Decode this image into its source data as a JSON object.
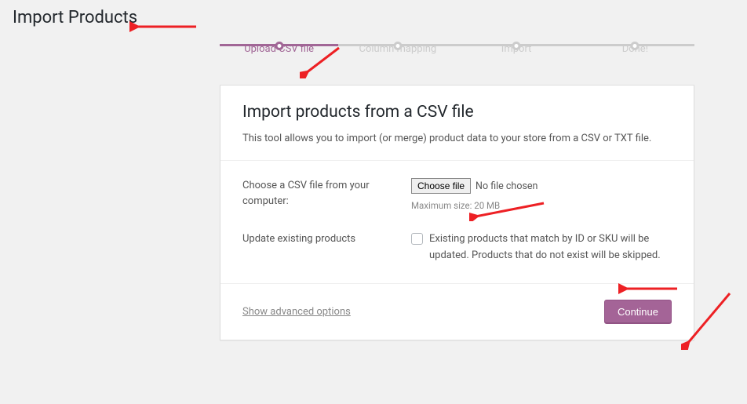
{
  "page_title": "Import Products",
  "steps": [
    {
      "label": "Upload CSV file"
    },
    {
      "label": "Column mapping"
    },
    {
      "label": "Import"
    },
    {
      "label": "Done!"
    }
  ],
  "card": {
    "title": "Import products from a CSV file",
    "description": "This tool allows you to import (or merge) product data to your store from a CSV or TXT file."
  },
  "form": {
    "choose_label": "Choose a CSV file from your computer:",
    "choose_file_btn": "Choose file",
    "no_file": "No file chosen",
    "max_size": "Maximum size: 20 MB",
    "update_label": "Update existing products",
    "update_desc": "Existing products that match by ID or SKU will be updated. Products that do not exist will be skipped."
  },
  "footer": {
    "advanced": "Show advanced options",
    "continue": "Continue"
  }
}
